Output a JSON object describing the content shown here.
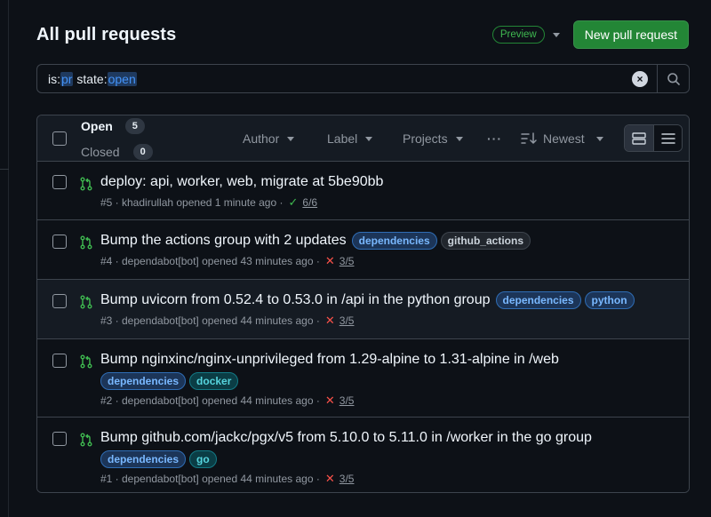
{
  "page": {
    "title": "All pull requests"
  },
  "header": {
    "preview_label": "Preview",
    "new_pr_label": "New pull request"
  },
  "search": {
    "qualifiers": [
      {
        "key": "is:",
        "value": "pr"
      },
      {
        "key": "state:",
        "value": "open"
      }
    ]
  },
  "states": {
    "open": {
      "label": "Open",
      "count": "5"
    },
    "closed": {
      "label": "Closed",
      "count": "0"
    }
  },
  "filters": {
    "author": "Author",
    "label": "Label",
    "projects": "Projects",
    "more": "···",
    "sort": "Newest"
  },
  "pull_requests": [
    {
      "title": "deploy: api, worker, web, migrate at 5be90bb",
      "labels": [],
      "meta": "#5 · khadirullah opened 1 minute ago ·",
      "status": "success",
      "checks": "6/6"
    },
    {
      "title": "Bump the actions group with 2 updates",
      "labels": [
        {
          "name": "dependencies",
          "color": "blue"
        },
        {
          "name": "github_actions",
          "color": "gray"
        }
      ],
      "meta": "#4 · dependabot[bot] opened 43 minutes ago ·",
      "status": "failure",
      "checks": "3/5"
    },
    {
      "title": "Bump uvicorn from 0.52.4 to 0.53.0 in /api in the python group",
      "labels": [
        {
          "name": "dependencies",
          "color": "blue"
        },
        {
          "name": "python",
          "color": "blue"
        }
      ],
      "meta": "#3 · dependabot[bot] opened 44 minutes ago ·",
      "status": "failure",
      "checks": "3/5"
    },
    {
      "title": "Bump nginxinc/nginx-unprivileged from 1.29-alpine to 1.31-alpine in /web",
      "labels": [
        {
          "name": "dependencies",
          "color": "blue"
        },
        {
          "name": "docker",
          "color": "teal"
        }
      ],
      "meta": "#2 · dependabot[bot] opened 44 minutes ago ·",
      "status": "failure",
      "checks": "3/5"
    },
    {
      "title": "Bump github.com/jackc/pgx/v5 from 5.10.0 to 5.11.0 in /worker in the go group",
      "labels": [
        {
          "name": "dependencies",
          "color": "blue"
        },
        {
          "name": "go",
          "color": "teal"
        }
      ],
      "meta": "#1 · dependabot[bot] opened 44 minutes ago ·",
      "status": "failure",
      "checks": "3/5"
    }
  ],
  "colors": {
    "accent_green": "#238636",
    "open_icon": "#3fb950",
    "failure": "#f85149",
    "label_blue_bg": "#1c3558",
    "label_blue_fg": "#79b8ff",
    "label_teal_bg": "#0b3d45",
    "label_teal_fg": "#56d4dd"
  },
  "icons": {
    "pull_request": "git-pull-request-icon",
    "search": "search-icon",
    "clear": "x-circle-icon",
    "sort": "sort-desc-icon",
    "view_card": "rows-icon",
    "view_list": "list-icon"
  }
}
